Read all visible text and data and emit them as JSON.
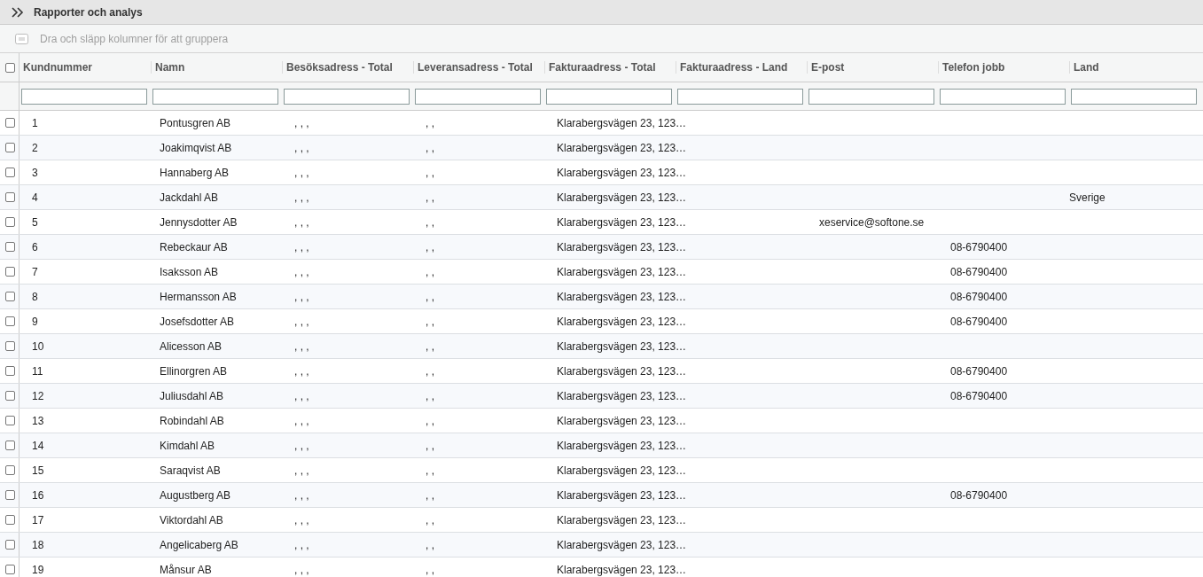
{
  "header": {
    "title": "Rapporter och analys"
  },
  "group_bar": {
    "hint": "Dra och släpp kolumner för att gruppera"
  },
  "table": {
    "select_all": {
      "checked": false
    },
    "columns": [
      "Kundnummer",
      "Namn",
      "Besöksadress - Total",
      "Leveransadress - Total",
      "Fakturaadress - Total",
      "Fakturaadress - Land",
      "E-post",
      "Telefon jobb",
      "Land"
    ],
    "rows": [
      {
        "checked": false,
        "kundnummer": "1",
        "namn": "Pontusgren AB",
        "besoksadress": ", , ,",
        "leveransadress": ", ,",
        "fakturaadress": "Klarabergsvägen 23, 123…"
      },
      {
        "checked": false,
        "kundnummer": "2",
        "namn": "Joakimqvist AB",
        "besoksadress": ", , ,",
        "leveransadress": ", ,",
        "fakturaadress": "Klarabergsvägen 23, 123…"
      },
      {
        "checked": false,
        "kundnummer": "3",
        "namn": "Hannaberg AB",
        "besoksadress": ", , ,",
        "leveransadress": ", ,",
        "fakturaadress": "Klarabergsvägen 23, 123…"
      },
      {
        "checked": false,
        "kundnummer": "4",
        "namn": "Jackdahl AB",
        "besoksadress": ", , ,",
        "leveransadress": ", ,",
        "fakturaadress": "Klarabergsvägen 23, 123…",
        "land": "Sverige"
      },
      {
        "checked": false,
        "kundnummer": "5",
        "namn": "Jennysdotter AB",
        "besoksadress": ", , ,",
        "leveransadress": ", ,",
        "fakturaadress": "Klarabergsvägen 23, 123…",
        "epost": "xeservice@softone.se"
      },
      {
        "checked": false,
        "kundnummer": "6",
        "namn": "Rebeckaur AB",
        "besoksadress": ", , ,",
        "leveransadress": ", ,",
        "fakturaadress": "Klarabergsvägen 23, 123…",
        "telefon": "08-6790400"
      },
      {
        "checked": false,
        "kundnummer": "7",
        "namn": "Isaksson AB",
        "besoksadress": ", , ,",
        "leveransadress": ", ,",
        "fakturaadress": "Klarabergsvägen 23, 123…",
        "telefon": "08-6790400"
      },
      {
        "checked": false,
        "kundnummer": "8",
        "namn": "Hermansson AB",
        "besoksadress": ", , ,",
        "leveransadress": ", ,",
        "fakturaadress": "Klarabergsvägen 23, 123…",
        "telefon": "08-6790400"
      },
      {
        "checked": false,
        "kundnummer": "9",
        "namn": "Josefsdotter AB",
        "besoksadress": ", , ,",
        "leveransadress": ", ,",
        "fakturaadress": "Klarabergsvägen 23, 123…",
        "telefon": "08-6790400"
      },
      {
        "checked": false,
        "kundnummer": "10",
        "namn": "Alicesson AB",
        "besoksadress": ", , ,",
        "leveransadress": ", ,",
        "fakturaadress": "Klarabergsvägen 23, 123…"
      },
      {
        "checked": false,
        "kundnummer": "11",
        "namn": "Ellinorgren AB",
        "besoksadress": ", , ,",
        "leveransadress": ", ,",
        "fakturaadress": "Klarabergsvägen 23, 123…",
        "telefon": "08-6790400"
      },
      {
        "checked": false,
        "kundnummer": "12",
        "namn": "Juliusdahl AB",
        "besoksadress": ", , ,",
        "leveransadress": ", ,",
        "fakturaadress": "Klarabergsvägen 23, 123…",
        "telefon": "08-6790400"
      },
      {
        "checked": false,
        "kundnummer": "13",
        "namn": "Robindahl AB",
        "besoksadress": ", , ,",
        "leveransadress": ", ,",
        "fakturaadress": "Klarabergsvägen 23, 123…"
      },
      {
        "checked": false,
        "kundnummer": "14",
        "namn": "Kimdahl AB",
        "besoksadress": ", , ,",
        "leveransadress": ", ,",
        "fakturaadress": "Klarabergsvägen 23, 123…"
      },
      {
        "checked": false,
        "kundnummer": "15",
        "namn": "Saraqvist AB",
        "besoksadress": ", , ,",
        "leveransadress": ", ,",
        "fakturaadress": "Klarabergsvägen 23, 123…"
      },
      {
        "checked": false,
        "kundnummer": "16",
        "namn": "Augustberg AB",
        "besoksadress": ", , ,",
        "leveransadress": ", ,",
        "fakturaadress": "Klarabergsvägen 23, 123…",
        "telefon": "08-6790400"
      },
      {
        "checked": false,
        "kundnummer": "17",
        "namn": "Viktordahl AB",
        "besoksadress": ", , ,",
        "leveransadress": ", ,",
        "fakturaadress": "Klarabergsvägen 23, 123…"
      },
      {
        "checked": false,
        "kundnummer": "18",
        "namn": "Angelicaberg AB",
        "besoksadress": ", , ,",
        "leveransadress": ", ,",
        "fakturaadress": "Klarabergsvägen 23, 123…"
      },
      {
        "checked": false,
        "kundnummer": "19",
        "namn": "Månsur AB",
        "besoksadress": ", , ,",
        "leveransadress": ", ,",
        "fakturaadress": "Klarabergsvägen 23, 123…"
      }
    ]
  }
}
